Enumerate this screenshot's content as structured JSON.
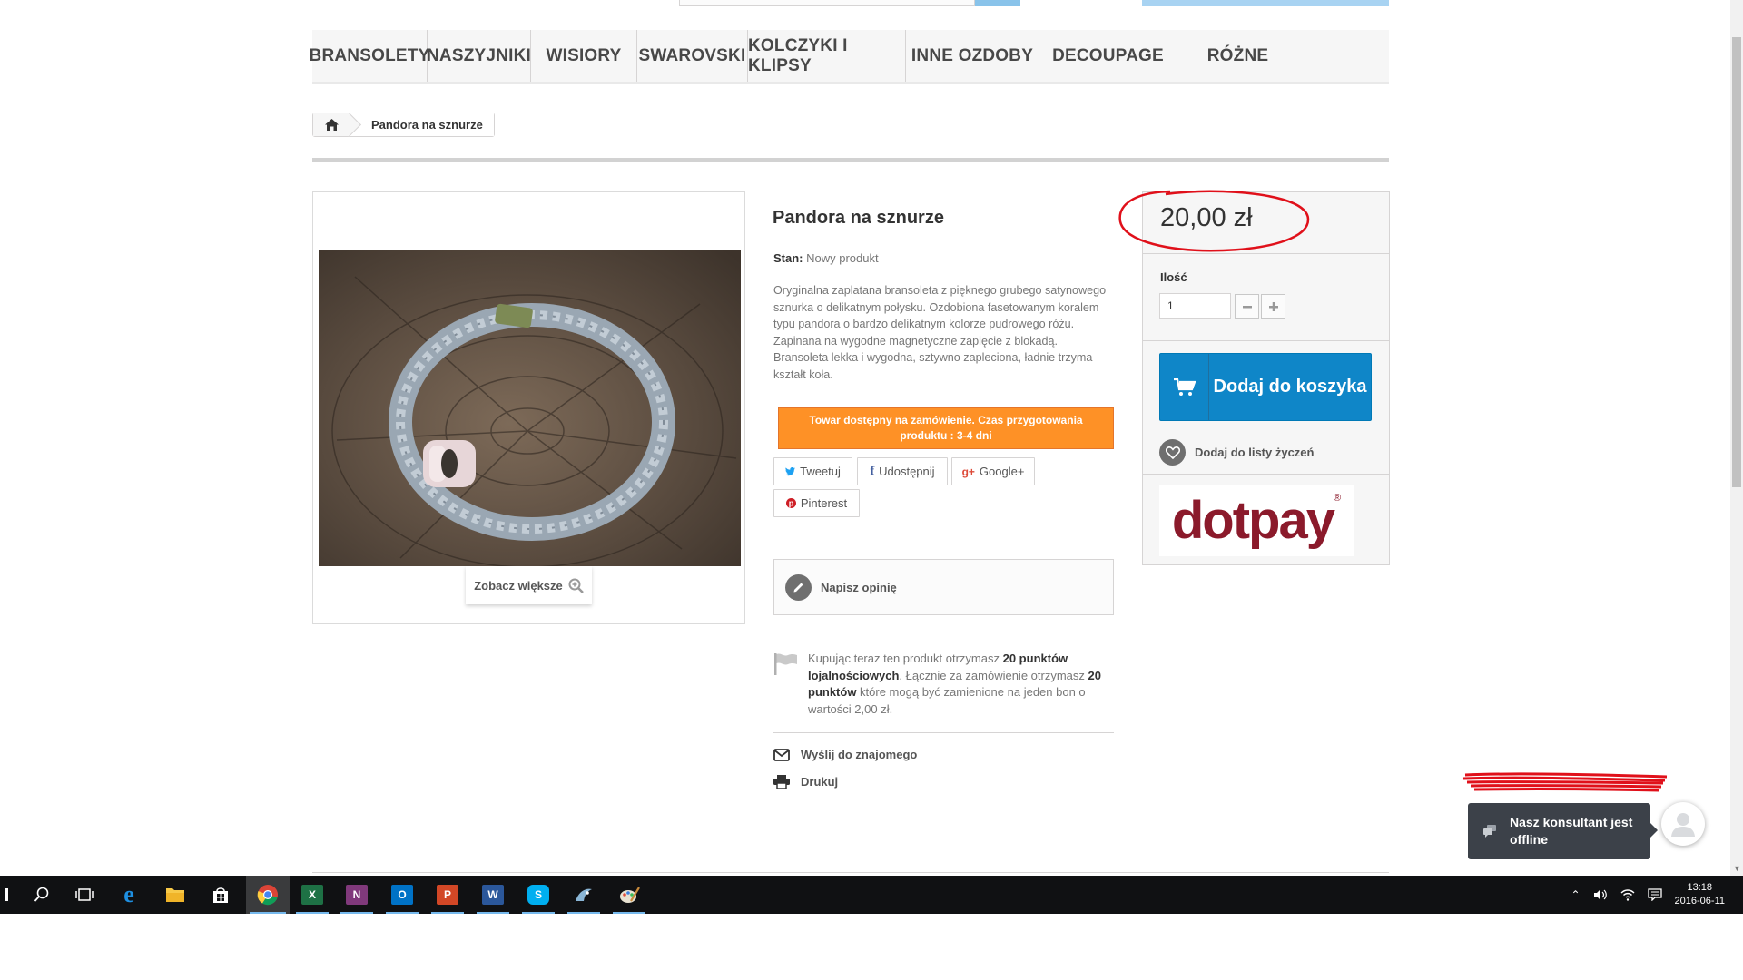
{
  "menu": {
    "items": [
      {
        "label": "BRANSOLETY"
      },
      {
        "label": "NASZYJNIKI"
      },
      {
        "label": "WISIORY"
      },
      {
        "label": "SWAROVSKI"
      },
      {
        "label": "KOLCZYKI I KLIPSY"
      },
      {
        "label": "INNE OZDOBY"
      },
      {
        "label": "DECOUPAGE"
      },
      {
        "label": "RÓŻNE"
      }
    ]
  },
  "breadcrumb": {
    "home_icon": "home-icon",
    "current": "Pandora na sznurze"
  },
  "product": {
    "title": "Pandora na sznurze",
    "condition_label": "Stan:",
    "condition_value": "Nowy produkt",
    "description": "Oryginalna zaplatana bransoleta z pięknego grubego satynowego sznurka o delikatnym połysku. Ozdobiona fasetowanym koralem typu pandora o bardzo delikatnym kolorze pudrowego różu. Zapinana na wygodne magnetyczne zapięcie z blokadą. Bransoleta lekka i wygodna, sztywno zapleciona, ładnie trzyma kształt koła.",
    "availability": "Towar dostępny na zamówienie. Czas przygotowania produktu : 3-4 dni",
    "view_larger": "Zobacz większe"
  },
  "social": {
    "tweet": "Tweetuj",
    "share": "Udostępnij",
    "google": "Google+",
    "pinterest": "Pinterest"
  },
  "review": {
    "label": "Napisz opinię"
  },
  "loyalty": {
    "part1": "Kupując teraz ten produkt otrzymasz ",
    "points1": "20 punktów lojalnościowych",
    "part2": ". Łącznie za zamówienie otrzymasz ",
    "points2": "20 punktów",
    "part3": " które mogą być zamienione na jeden bon o wartości 2,00 zł."
  },
  "links": {
    "send_friend": "Wyślij do znajomego",
    "print": "Drukuj"
  },
  "buy": {
    "price": "20,00 zł",
    "qty_label": "Ilość",
    "qty_value": "1",
    "add_to_cart": "Dodaj do koszyka",
    "wishlist": "Dodaj do listy życzeń",
    "payment_logo": "dotpay"
  },
  "chat": {
    "status": "Nasz konsultant jest offline"
  },
  "taskbar": {
    "time": "13:18",
    "date": "2016-06-11"
  },
  "colors": {
    "cart_button": "#0f86c8",
    "availability_bg": "#fe9126",
    "annotation_red": "#e0101a"
  }
}
